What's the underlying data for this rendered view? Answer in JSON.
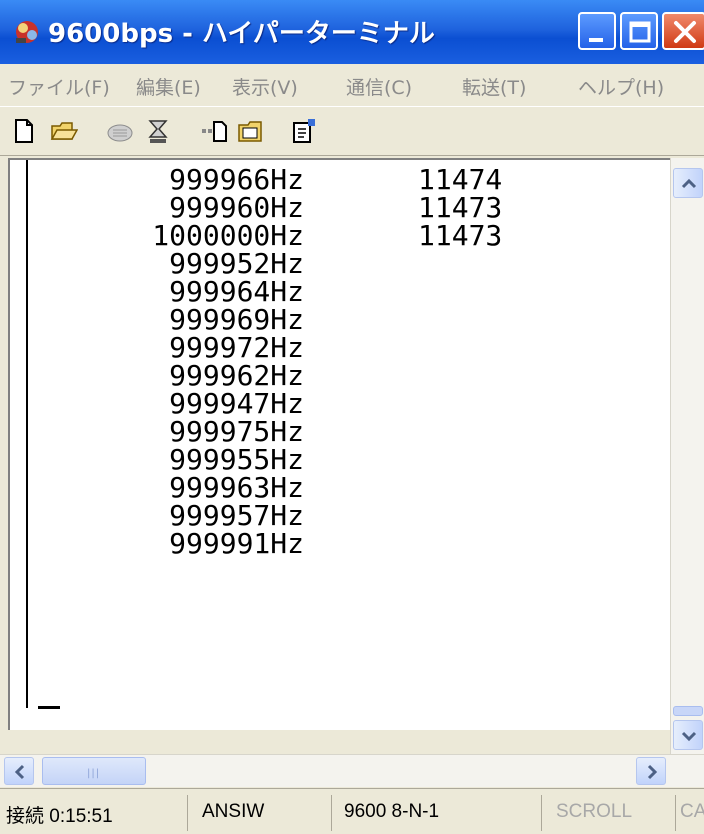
{
  "window": {
    "title": "9600bps - ハイパーターミナル"
  },
  "menu": {
    "items": [
      "ファイル(F)",
      "編集(E)",
      "表示(V)",
      "通信(C)",
      "転送(T)",
      "ヘルプ(H)"
    ]
  },
  "toolbar": {
    "icons": [
      "new-document-icon",
      "open-folder-icon",
      "phone-call-icon",
      "disconnect-icon",
      "send-icon",
      "receive-icon",
      "properties-icon"
    ]
  },
  "terminal": {
    "rows": [
      {
        "freq": "999966Hz",
        "count": "11474"
      },
      {
        "freq": "999960Hz",
        "count": "11473"
      },
      {
        "freq": "1000000Hz",
        "count": "11473"
      },
      {
        "freq": "999952Hz",
        "count": ""
      },
      {
        "freq": "999964Hz",
        "count": ""
      },
      {
        "freq": "999969Hz",
        "count": ""
      },
      {
        "freq": "999972Hz",
        "count": ""
      },
      {
        "freq": "999962Hz",
        "count": ""
      },
      {
        "freq": "999947Hz",
        "count": ""
      },
      {
        "freq": "999975Hz",
        "count": ""
      },
      {
        "freq": "999955Hz",
        "count": ""
      },
      {
        "freq": "999963Hz",
        "count": ""
      },
      {
        "freq": "999957Hz",
        "count": ""
      },
      {
        "freq": "999991Hz",
        "count": ""
      }
    ],
    "cursor": "_"
  },
  "status": {
    "connected": "接続 0:15:51",
    "emulation": "ANSIW",
    "settings": "9600 8-N-1",
    "scroll": "SCROLL",
    "caps": "CAPS"
  },
  "colors": {
    "titlebar": "#1f63de",
    "background": "#ece9d8",
    "terminal_bg": "#ffffff"
  }
}
